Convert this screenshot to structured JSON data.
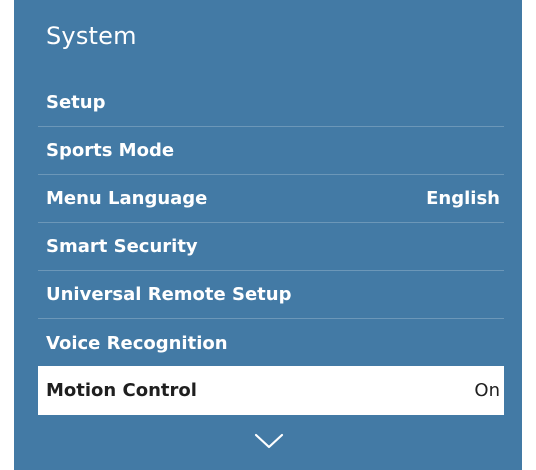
{
  "window": {
    "title": "System"
  },
  "menu": {
    "items": [
      {
        "label": "Setup",
        "value": ""
      },
      {
        "label": "Sports Mode",
        "value": ""
      },
      {
        "label": "Menu Language",
        "value": "English"
      },
      {
        "label": "Smart Security",
        "value": ""
      },
      {
        "label": "Universal Remote Setup",
        "value": ""
      },
      {
        "label": "Voice Recognition",
        "value": ""
      },
      {
        "label": "Motion Control",
        "value": "On"
      }
    ],
    "selected_index": 6
  },
  "icons": {
    "scroll": "chevron-down-icon"
  },
  "colors": {
    "panel_background": "#437aa5",
    "selected_background": "#ffffff",
    "selected_text": "#1f1f1f",
    "text": "#ffffff"
  }
}
